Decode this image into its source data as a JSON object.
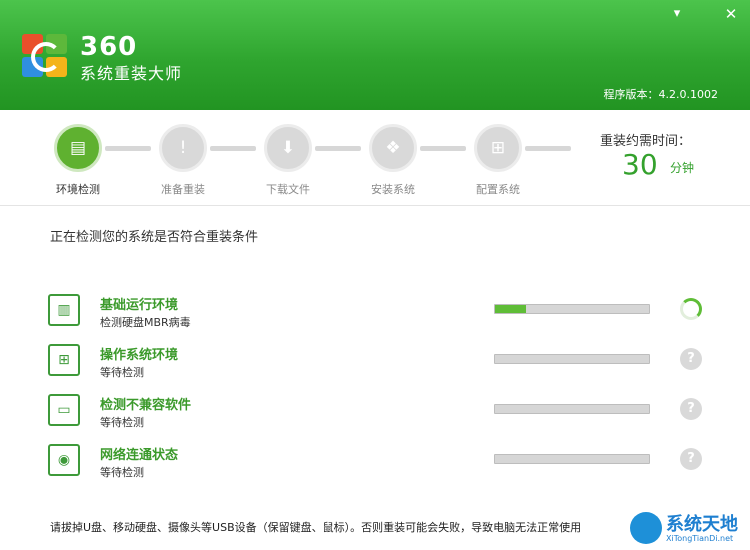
{
  "header": {
    "brand_num": "360",
    "brand_name": "系统重装大师",
    "version": "程序版本：4.2.0.1002",
    "menu_icon": "menu-icon",
    "close_icon": "close-icon"
  },
  "steps": [
    {
      "label": "环境检测",
      "active": true,
      "icon": "computer-check-icon"
    },
    {
      "label": "准备重装",
      "active": false,
      "icon": "prepare-icon"
    },
    {
      "label": "下载文件",
      "active": false,
      "icon": "download-icon"
    },
    {
      "label": "安装系统",
      "active": false,
      "icon": "install-icon"
    },
    {
      "label": "配置系统",
      "active": false,
      "icon": "windows-config-icon"
    }
  ],
  "time": {
    "label": "重装约需时间：",
    "value": "30",
    "unit": "分钟"
  },
  "main": {
    "title": "正在检测您的系统是否符合重装条件"
  },
  "checks": [
    {
      "title": "基础运行环境",
      "sub": "检测硬盘MBR病毒",
      "progress": 0.2,
      "status": "running",
      "icon": "hardware-icon"
    },
    {
      "title": "操作系统环境",
      "sub": "等待检测",
      "progress": 0,
      "status": "waiting",
      "icon": "windows-icon"
    },
    {
      "title": "检测不兼容软件",
      "sub": "等待检测",
      "progress": 0,
      "status": "waiting",
      "icon": "monitor-icon"
    },
    {
      "title": "网络连通状态",
      "sub": "等待检测",
      "progress": 0,
      "status": "waiting",
      "icon": "globe-icon"
    }
  ],
  "wait_symbol": "?",
  "footer": {
    "text": "请拔掉U盘、移动硬盘、摄像头等USB设备（保留键盘、鼠标）。否则重装可能会失败，导致电脑无法正常使用"
  },
  "watermark": {
    "text": "系统天地",
    "url": "XiTongTianDi.net"
  },
  "colors": {
    "accent": "#34a12d",
    "header": "#2fa52f",
    "progress": "#5fbd37"
  }
}
